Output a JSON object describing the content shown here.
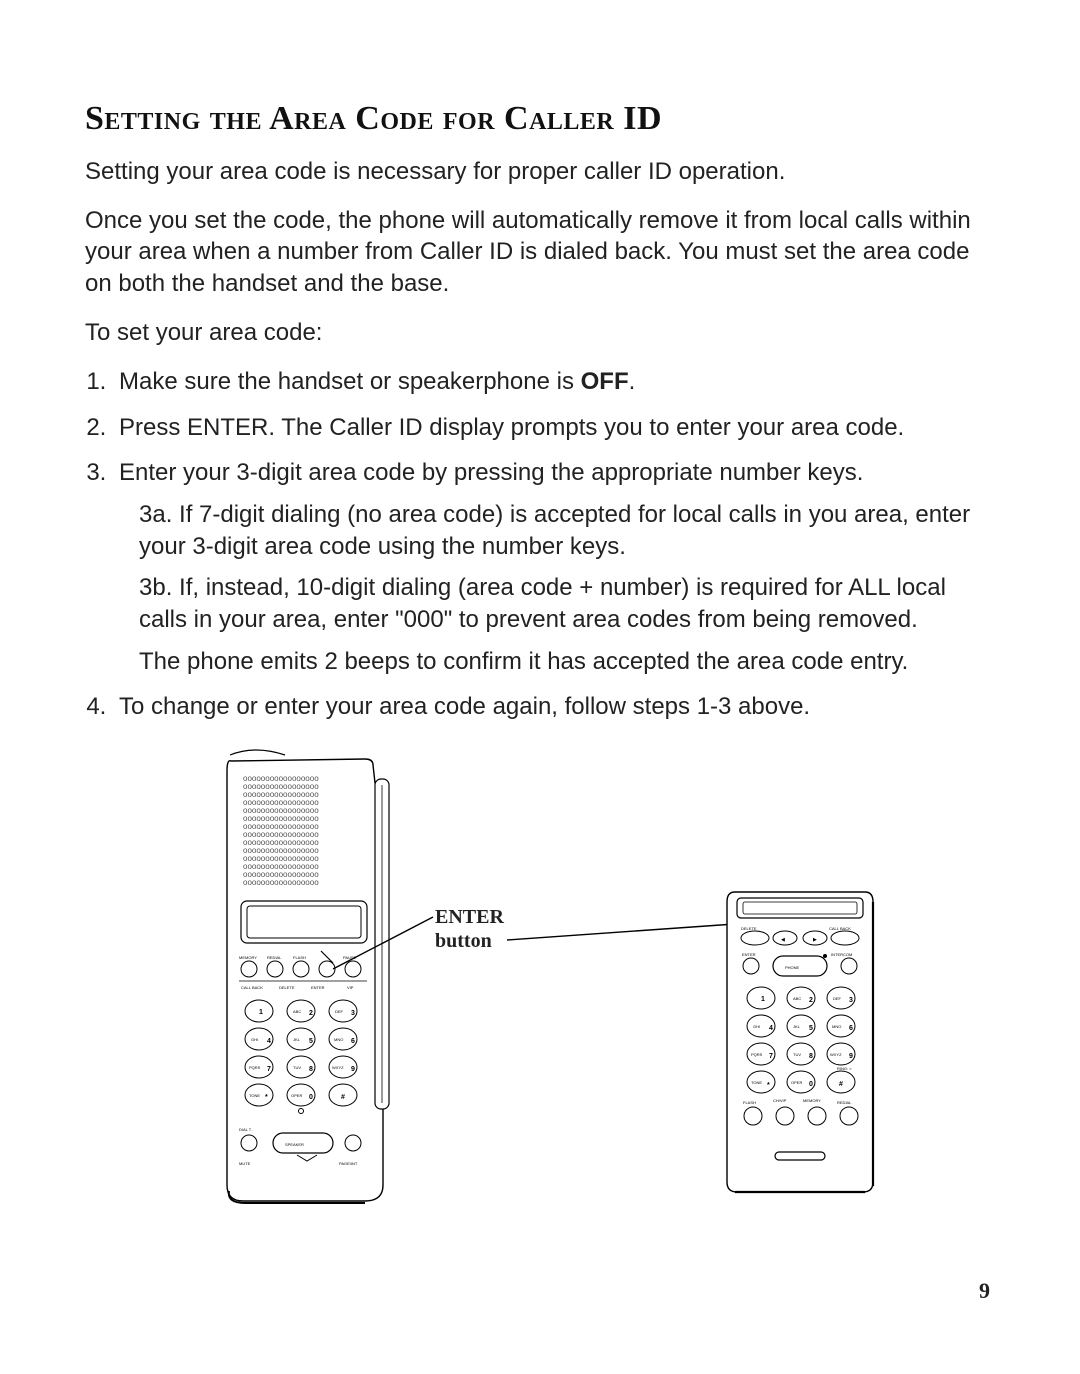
{
  "title": "Setting the Area Code for Caller ID",
  "para1": "Setting your area code is necessary for proper caller ID operation.",
  "para2": "Once you set the code, the phone will automatically remove it from local calls within your area when a number from Caller ID is dialed back. You must set the area code on both the handset and the base.",
  "para3": "To set your area code:",
  "steps": {
    "s1_a": "Make sure the handset or speakerphone is ",
    "s1_b": "OFF",
    "s1_c": ".",
    "s2": "Press ENTER. The Caller ID display prompts you to enter your area code.",
    "s3": "Enter your 3-digit area code by pressing the appropriate number keys.",
    "s3a": "3a. If 7-digit dialing (no area code) is accepted for local calls in you area, enter your 3-digit area code using the number keys.",
    "s3b": "3b.  If, instead, 10-digit dialing (area code + number) is required for ALL local calls in your area, enter \"000\" to prevent area codes from being removed.",
    "s3note": "The phone emits 2 beeps to confirm it has accepted the area code entry.",
    "s4": "To change or enter your area code again, follow steps 1-3 above."
  },
  "fig": {
    "enter_l1": "ENTER",
    "enter_l2": "button",
    "base_btn_row_labels": [
      "MEMORY",
      "REDIAL",
      "FLASH",
      "",
      "PAUSE"
    ],
    "base_btn_under_labels": [
      "CALL BACK",
      "DELETE",
      "ENTER",
      "VIP"
    ],
    "keypad": [
      {
        "d": "1",
        "sub": ""
      },
      {
        "d": "2",
        "sub": "ABC"
      },
      {
        "d": "3",
        "sub": "DEF"
      },
      {
        "d": "4",
        "sub": "GHI"
      },
      {
        "d": "5",
        "sub": "JKL"
      },
      {
        "d": "6",
        "sub": "MNO"
      },
      {
        "d": "7",
        "sub": "PQRS"
      },
      {
        "d": "8",
        "sub": "TUV"
      },
      {
        "d": "9",
        "sub": "WXYZ"
      },
      {
        "d": "*",
        "sub": "TONE"
      },
      {
        "d": "0",
        "sub": "OPER"
      },
      {
        "d": "#",
        "sub": ""
      }
    ],
    "base_bottom": {
      "dial": "DIAL T .",
      "speaker": "SPEAKER",
      "mute": "MUTE",
      "pageint": "PAGE/INT"
    },
    "remote_top_labels": [
      "DELETE",
      "",
      "CALL BACK"
    ],
    "remote_mid_labels": [
      "",
      "PHONE",
      "INTERCOM"
    ],
    "remote_bottom_labels": [
      "FLASH",
      "CH/VIP",
      "MEMORY",
      "REDIAL"
    ],
    "enter_label_near": "ENTER",
    "ringer_label": "RING: >"
  },
  "page_number": "9"
}
